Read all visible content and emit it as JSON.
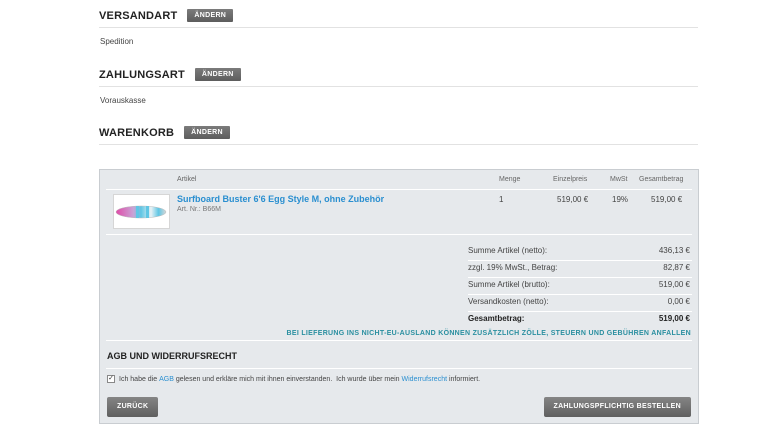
{
  "shipping": {
    "title": "VERSANDART",
    "change_label": "ÄNDERN",
    "value": "Spedition"
  },
  "payment": {
    "title": "ZAHLUNGSART",
    "change_label": "ÄNDERN",
    "value": "Vorauskasse"
  },
  "cart": {
    "title": "WARENKORB",
    "change_label": "ÄNDERN",
    "columns": {
      "article": "Artikel",
      "quantity": "Menge",
      "unit_price": "Einzelpreis",
      "vat": "MwSt",
      "total": "Gesamtbetrag"
    },
    "items": [
      {
        "name": "Surfboard Buster 6'6 Egg Style M, ohne Zubehör",
        "article_no": "Art. Nr.: B66M",
        "quantity": "1",
        "unit_price": "519,00 €",
        "vat": "19%",
        "total": "519,00 €"
      }
    ],
    "summary": [
      {
        "label": "Summe Artikel (netto):",
        "value": "436,13 €"
      },
      {
        "label": "zzgl. 19% MwSt., Betrag:",
        "value": "82,87 €"
      },
      {
        "label": "Summe Artikel (brutto):",
        "value": "519,00 €"
      },
      {
        "label": "Versandkosten (netto):",
        "value": "0,00 €"
      },
      {
        "label": "Gesamtbetrag:",
        "value": "519,00 €"
      }
    ],
    "notice": "BEI LIEFERUNG INS NICHT-EU-AUSLAND KÖNNEN ZUSÄTZLICH ZÖLLE, STEUERN UND GEBÜHREN ANFALLEN"
  },
  "agb": {
    "title": "AGB UND WIDERRUFSRECHT",
    "checked": true,
    "text_1": "Ich habe die ",
    "link_agb": "AGB",
    "text_2": " gelesen und erkläre mich mit ihnen einverstanden.  Ich wurde über mein ",
    "link_withdrawal": "Widerrufsrecht",
    "text_3": " informiert."
  },
  "buttons": {
    "back": "ZURÜCK",
    "order": "ZAHLUNGSPFLICHTIG BESTELLEN"
  },
  "colors": {
    "link": "#2a8fd0",
    "notice": "#2a8fa0",
    "button": "#6e6e6e",
    "panel": "#e6e9ec"
  },
  "icons": {
    "checkbox": "checkmark-icon"
  }
}
